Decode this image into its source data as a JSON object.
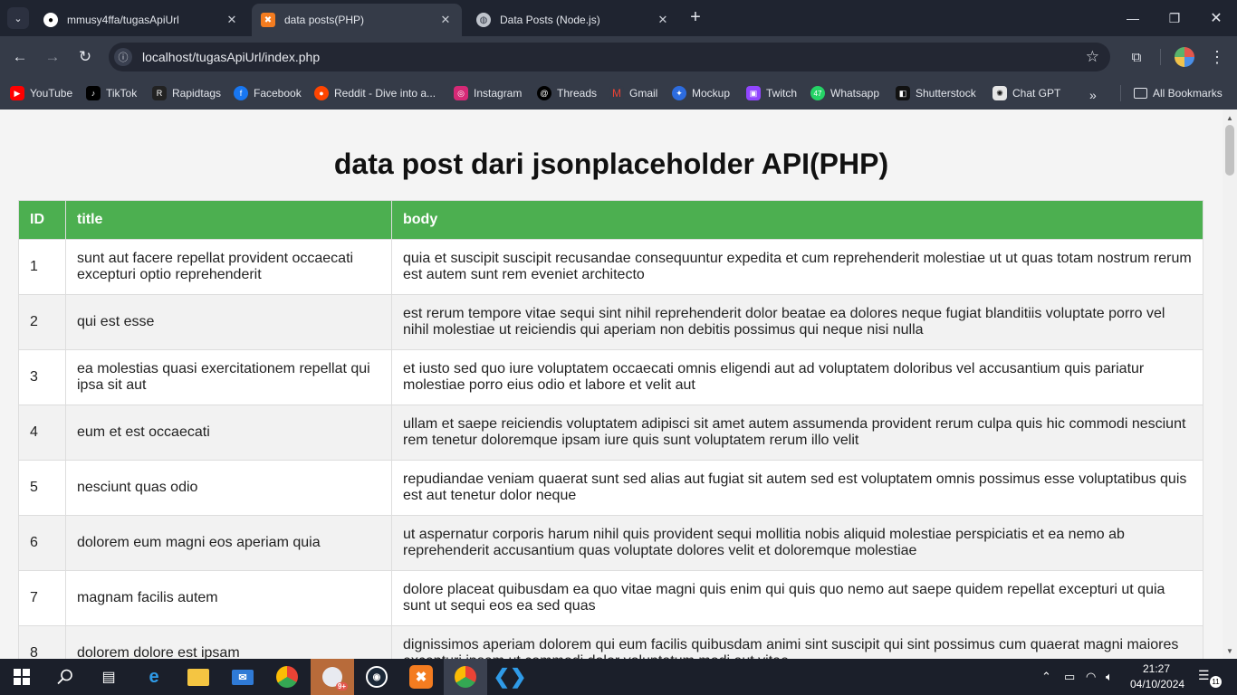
{
  "browser": {
    "tabs": [
      {
        "title": "mmusy4ffa/tugasApiUrl",
        "icon": "github-icon"
      },
      {
        "title": "data posts(PHP)",
        "icon": "xampp-icon"
      },
      {
        "title": "Data Posts (Node.js)",
        "icon": "globe-icon"
      }
    ],
    "url": "localhost/tugasApiUrl/index.php",
    "bookmarks": [
      {
        "label": "YouTube",
        "color": "#ff0000"
      },
      {
        "label": "TikTok",
        "color": "#000000"
      },
      {
        "label": "Rapidtags",
        "color": "#222222"
      },
      {
        "label": "Facebook",
        "color": "#1877f2"
      },
      {
        "label": "Reddit - Dive into a...",
        "color": "#ff4500"
      },
      {
        "label": "Instagram",
        "color": "#d62976"
      },
      {
        "label": "Threads",
        "color": "#000000"
      },
      {
        "label": "Gmail",
        "color": "#ea4335"
      },
      {
        "label": "Mockup",
        "color": "#2d6cdf"
      },
      {
        "label": "Twitch",
        "color": "#9146ff"
      },
      {
        "label": "Whatsapp",
        "color": "#25d366"
      },
      {
        "label": "Shutterstock",
        "color": "#111111"
      },
      {
        "label": "Chat GPT",
        "color": "#e6e6e6"
      }
    ],
    "all_bookmarks": "All Bookmarks"
  },
  "page": {
    "heading": "data post dari jsonplaceholder API(PHP)",
    "columns": [
      "ID",
      "title",
      "body"
    ],
    "rows": [
      {
        "id": "1",
        "title": "sunt aut facere repellat provident occaecati excepturi optio reprehenderit",
        "body": "quia et suscipit suscipit recusandae consequuntur expedita et cum reprehenderit molestiae ut ut quas totam nostrum rerum est autem sunt rem eveniet architecto"
      },
      {
        "id": "2",
        "title": "qui est esse",
        "body": "est rerum tempore vitae sequi sint nihil reprehenderit dolor beatae ea dolores neque fugiat blanditiis voluptate porro vel nihil molestiae ut reiciendis qui aperiam non debitis possimus qui neque nisi nulla"
      },
      {
        "id": "3",
        "title": "ea molestias quasi exercitationem repellat qui ipsa sit aut",
        "body": "et iusto sed quo iure voluptatem occaecati omnis eligendi aut ad voluptatem doloribus vel accusantium quis pariatur molestiae porro eius odio et labore et velit aut"
      },
      {
        "id": "4",
        "title": "eum et est occaecati",
        "body": "ullam et saepe reiciendis voluptatem adipisci sit amet autem assumenda provident rerum culpa quis hic commodi nesciunt rem tenetur doloremque ipsam iure quis sunt voluptatem rerum illo velit"
      },
      {
        "id": "5",
        "title": "nesciunt quas odio",
        "body": "repudiandae veniam quaerat sunt sed alias aut fugiat sit autem sed est voluptatem omnis possimus esse voluptatibus quis est aut tenetur dolor neque"
      },
      {
        "id": "6",
        "title": "dolorem eum magni eos aperiam quia",
        "body": "ut aspernatur corporis harum nihil quis provident sequi mollitia nobis aliquid molestiae perspiciatis et ea nemo ab reprehenderit accusantium quas voluptate dolores velit et doloremque molestiae"
      },
      {
        "id": "7",
        "title": "magnam facilis autem",
        "body": "dolore placeat quibusdam ea quo vitae magni quis enim qui quis quo nemo aut saepe quidem repellat excepturi ut quia sunt ut sequi eos ea sed quas"
      },
      {
        "id": "8",
        "title": "dolorem dolore est ipsam",
        "body": "dignissimos aperiam dolorem qui eum facilis quibusdam animi sint suscipit qui sint possimus cum quaerat magni maiores excepturi ipsam ut commodi dolor voluptatum modi aut vitae"
      }
    ]
  },
  "taskbar": {
    "time": "21:27",
    "date": "04/10/2024",
    "notification_count": "11",
    "steam_badge": "9+"
  },
  "colors": {
    "table_header": "#4caf50",
    "browser_frame": "#353b48"
  }
}
